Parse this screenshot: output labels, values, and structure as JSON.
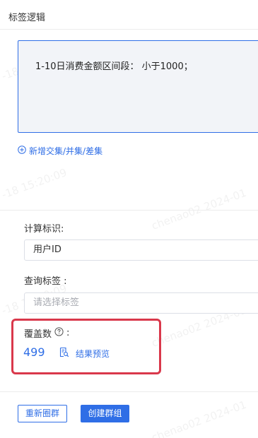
{
  "section": {
    "title": "标签逻辑"
  },
  "logic": {
    "expression": "1-10日消费金额区间段： 小于1000；"
  },
  "add_link": {
    "icon": "plus-circle-icon",
    "label": "新增交集/并集/差集"
  },
  "form": {
    "calc_id": {
      "label": "计算标识:",
      "value": "用户ID"
    },
    "query_tag": {
      "label": "查询标签 :",
      "placeholder": "请选择标签"
    }
  },
  "coverage": {
    "label": "覆盖数",
    "help_icon": "question-circle-icon",
    "colon": ":",
    "count": "499",
    "preview_icon": "document-search-icon",
    "preview_label": "结果预览"
  },
  "actions": {
    "reselect_label": "重新圈群",
    "create_label": "创建群组"
  },
  "watermarks": [
    {
      "text": "chenao02 2024-01"
    },
    {
      "text": "-18 15:20:09"
    },
    {
      "text": "-18 15:20:09"
    },
    {
      "text": "chenao02 2024-01"
    },
    {
      "text": "-18 15:20:09"
    },
    {
      "text": "chenao02 2024-01"
    },
    {
      "text": "-18 15:20:09"
    },
    {
      "text": "chenao02 2024-01"
    },
    {
      "text": "-18 15:20:09"
    },
    {
      "text": "chenao02 2024-01"
    }
  ],
  "colors": {
    "accent": "#2f6ee6",
    "highlight": "#d9384b"
  }
}
